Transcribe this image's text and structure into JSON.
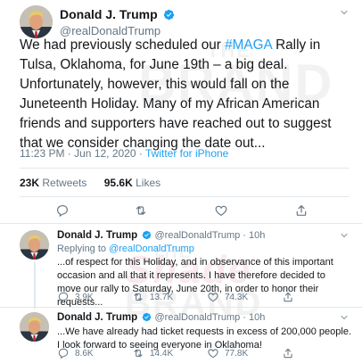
{
  "tweet": {
    "author_name": "Donald J. Trump",
    "author_handle": "@realDonaldTrump",
    "text_before_hashtag": "We had previously scheduled our ",
    "hashtag": "#MAGA",
    "text_after_hashtag": " Rally in Tulsa, Oklahoma, for June 19th – a big deal. Unfortunately, however, this would fall on the Juneteenth Holiday. Many of my African American friends and supporters have reached out to suggest that we consider changing the date out...",
    "timestamp": "11:23 PM · Jun 12, 2020 · ",
    "source": "Twitter for iPhone",
    "retweets_count": "23K",
    "retweets_label": "Retweets",
    "likes_count": "95.6K",
    "likes_label": "Likes"
  },
  "replies": [
    {
      "author_name": "Donald J. Trump",
      "author_handle": "@realDonaldTrump · 10h",
      "replying_prefix": "Replying to ",
      "replying_to": "@realDonaldTrump",
      "text": "...of respect for this Holiday, and in observance of this important occasion and all that it represents. I have therefore decided to move our rally to Saturday, June 20th, in order to honor their requests...",
      "reply_count": "3.9K",
      "retweet_count": "13.7K",
      "like_count": "74.3K"
    },
    {
      "author_name": "Donald J. Trump",
      "author_handle": "@realDonaldTrump · 10h",
      "text": "...We have already had ticket requests in excess of 200,000 people. I look forward to seeing everyone in Oklahoma!",
      "reply_count": "8.6K",
      "retweet_count": "14.4K",
      "like_count": "77.8K"
    }
  ],
  "watermark": {
    "line1": "THE",
    "line2": "Shade",
    "line3": "BRAND"
  },
  "colors": {
    "accent": "#1da1f2",
    "text": "#14171a",
    "muted": "#657786",
    "divider": "#e1e8ed"
  },
  "icons": [
    "verified-badge-icon",
    "chevron-down-icon",
    "reply-icon",
    "retweet-icon",
    "like-icon",
    "share-icon"
  ]
}
